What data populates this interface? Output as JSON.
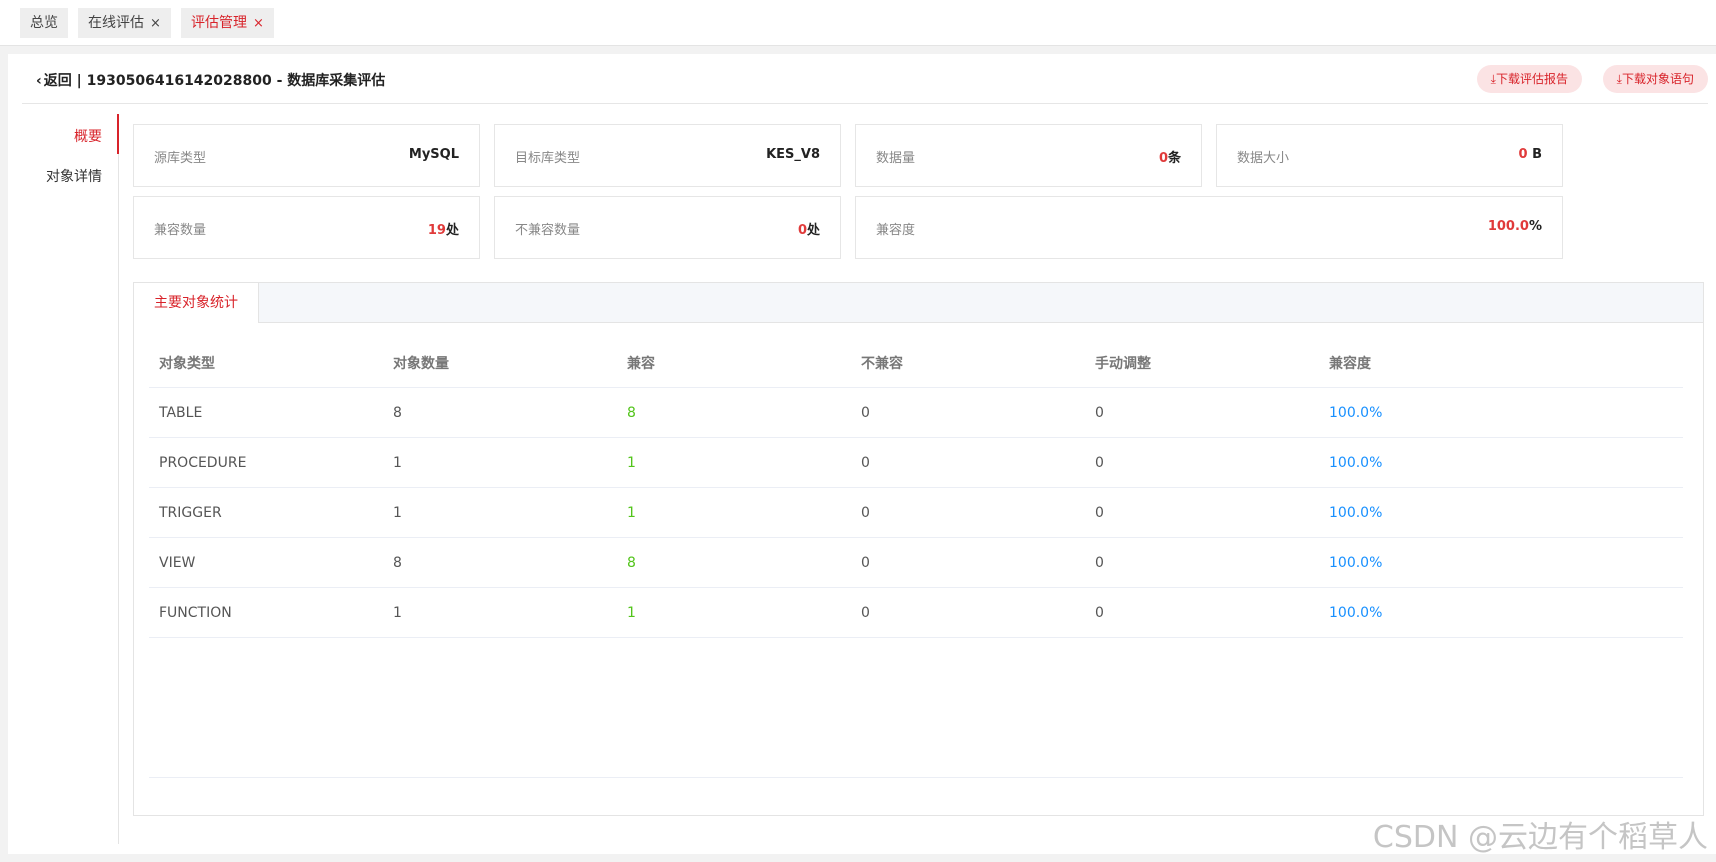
{
  "tabbar": {
    "tabs": [
      {
        "label": "总览",
        "closable": false,
        "active": false
      },
      {
        "label": "在线评估",
        "closable": true,
        "active": false
      },
      {
        "label": "评估管理",
        "closable": true,
        "active": true
      }
    ],
    "close_glyph": "×"
  },
  "header": {
    "back_label": "返回",
    "separator": "|",
    "title": "1930506416142028800 - 数据库采集评估",
    "buttons": [
      {
        "label": "下载评估报告",
        "icon": "download-icon"
      },
      {
        "label": "下载对象语句",
        "icon": "download-icon"
      }
    ]
  },
  "sidebar": {
    "items": [
      {
        "label": "概要",
        "active": true
      },
      {
        "label": "对象详情",
        "active": false
      }
    ]
  },
  "summary": {
    "source_type": {
      "label": "源库类型",
      "value": "MySQL"
    },
    "target_type": {
      "label": "目标库类型",
      "value": "KES_V8"
    },
    "data_count": {
      "label": "数据量",
      "value": "0",
      "unit": "条"
    },
    "data_size": {
      "label": "数据大小",
      "value": "0",
      "unit": " B"
    },
    "compatible_count": {
      "label": "兼容数量",
      "value": "19",
      "unit": "处"
    },
    "incompatible_count": {
      "label": "不兼容数量",
      "value": "0",
      "unit": "处"
    },
    "compatibility": {
      "label": "兼容度",
      "value": "100.0",
      "unit": "%"
    }
  },
  "object_stats": {
    "tab_label": "主要对象统计",
    "columns": [
      "对象类型",
      "对象数量",
      "兼容",
      "不兼容",
      "手动调整",
      "兼容度"
    ],
    "rows": [
      {
        "type": "TABLE",
        "count": "8",
        "compatible": "8",
        "incompatible": "0",
        "manual": "0",
        "rate": "100.0%"
      },
      {
        "type": "PROCEDURE",
        "count": "1",
        "compatible": "1",
        "incompatible": "0",
        "manual": "0",
        "rate": "100.0%"
      },
      {
        "type": "TRIGGER",
        "count": "1",
        "compatible": "1",
        "incompatible": "0",
        "manual": "0",
        "rate": "100.0%"
      },
      {
        "type": "VIEW",
        "count": "8",
        "compatible": "8",
        "incompatible": "0",
        "manual": "0",
        "rate": "100.0%"
      },
      {
        "type": "FUNCTION",
        "count": "1",
        "compatible": "1",
        "incompatible": "0",
        "manual": "0",
        "rate": "100.0%"
      }
    ]
  },
  "watermark": "CSDN @云边有个稻草人",
  "colors": {
    "accent": "#d8232a",
    "green": "#52c41a",
    "blue": "#1890ff"
  }
}
